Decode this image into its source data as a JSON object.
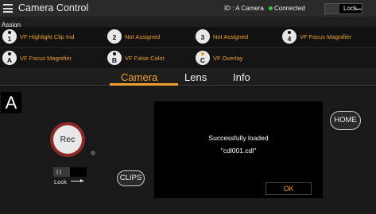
{
  "titlebar": {
    "title": "Camera Control",
    "camera_id": "ID : A Camera",
    "connection": "Connected",
    "lock_label": "Lock"
  },
  "assign": {
    "label": "Assign",
    "buttons": [
      {
        "num": "1",
        "label": "VF Highlight Clip Ind"
      },
      {
        "num": "2",
        "label": "Not Assigned"
      },
      {
        "num": "3",
        "label": "Not Assigned"
      },
      {
        "num": "4",
        "label": "VF Focus Magnifier"
      },
      {
        "num": "A",
        "label": "VF Focus Magnifier"
      },
      {
        "num": "B",
        "label": "VF False Color"
      },
      {
        "num": "C",
        "label": "VF Overlay"
      }
    ]
  },
  "tabs": [
    "Camera",
    "Lens",
    "Info"
  ],
  "camera": {
    "letter": "A",
    "rec_label": "Rec",
    "lock_label": "Lock",
    "clips_label": "CLIPS",
    "home_label": "HOME"
  },
  "dialog": {
    "line1": "Successfully loaded",
    "line2": "\"cdl001.cdl\"",
    "ok_label": "OK"
  },
  "colors": {
    "accent": "#f0a030",
    "rec": "#8c2a2a",
    "connected": "#35d04a"
  }
}
